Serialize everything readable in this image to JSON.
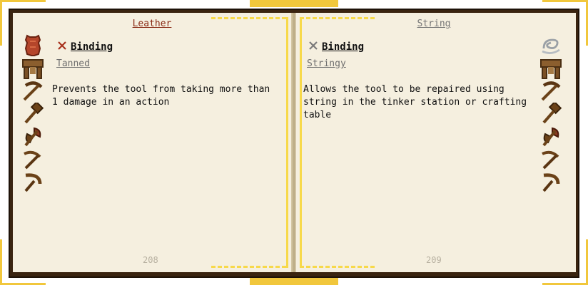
{
  "left_page": {
    "material": "Leather",
    "trait": {
      "icon": "crossed-swords-icon",
      "name": "Binding"
    },
    "variant": "Tanned",
    "description": "Prevents the tool from taking more than 1 damage in an action",
    "page_number": "208",
    "parts": [
      "leather-material-icon",
      "tool-station-icon",
      "pickaxe-icon",
      "hammer-icon",
      "battleaxe-icon",
      "scythe-icon",
      "sickle-icon"
    ]
  },
  "right_page": {
    "material": "String",
    "trait": {
      "icon": "crossed-swords-icon",
      "name": "Binding"
    },
    "variant": "Stringy",
    "description": "Allows the tool to be repaired using string in the tinker station or crafting table",
    "page_number": "209",
    "parts": [
      "string-material-icon",
      "tool-station-icon",
      "pickaxe-icon",
      "hammer-icon",
      "battleaxe-icon",
      "scythe-icon",
      "sickle-icon"
    ]
  },
  "colors": {
    "leather_title": "#8a2a14",
    "string_title": "#767676",
    "page": "#f5efdf",
    "cover": "#3a2410",
    "gold": "#f1c73c"
  }
}
